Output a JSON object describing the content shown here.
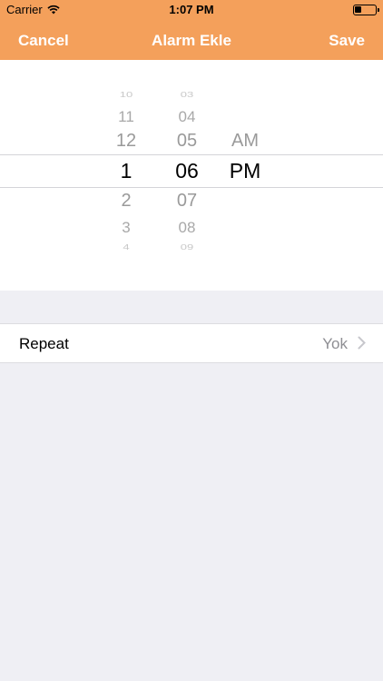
{
  "status_bar": {
    "carrier": "Carrier",
    "time": "1:07 PM",
    "battery_level": 0.35
  },
  "nav": {
    "cancel_label": "Cancel",
    "title": "Alarm Ekle",
    "save_label": "Save"
  },
  "picker": {
    "hours": [
      "10",
      "11",
      "12",
      "1",
      "2",
      "3",
      "4"
    ],
    "minutes": [
      "03",
      "04",
      "05",
      "06",
      "07",
      "08",
      "09"
    ],
    "periods": [
      "AM",
      "PM"
    ],
    "selected_hour": "1",
    "selected_minute": "06",
    "selected_period": "PM"
  },
  "settings": {
    "repeat_label": "Repeat",
    "repeat_value": "Yok"
  },
  "colors": {
    "accent": "#f4a05b",
    "background": "#efeff4"
  }
}
